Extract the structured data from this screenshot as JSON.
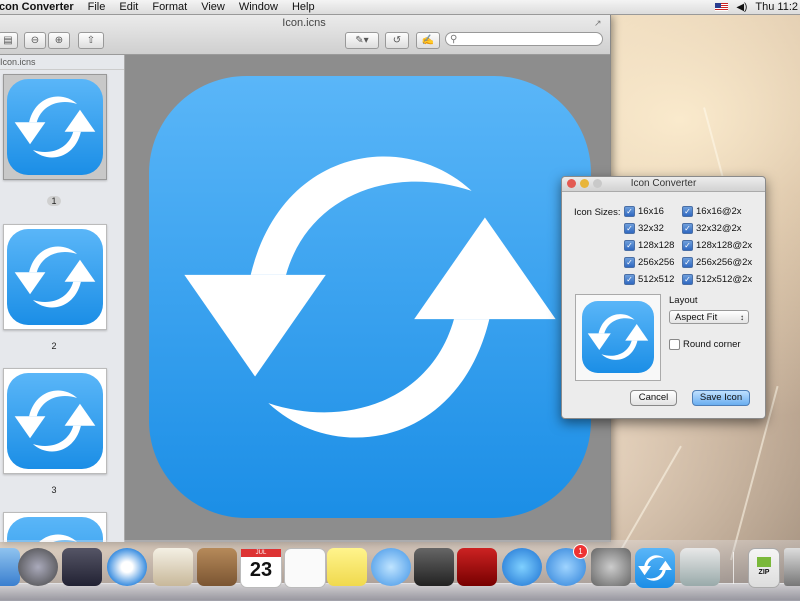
{
  "menubar": {
    "app_name": "Icon Converter",
    "menus": [
      "File",
      "Edit",
      "Format",
      "View",
      "Window",
      "Help"
    ],
    "clock": "Thu 11:2"
  },
  "preview": {
    "title": "Icon.icns",
    "sidebar_title": "Icon.icns",
    "pages": [
      "1",
      "2",
      "3"
    ],
    "search_placeholder": ""
  },
  "dialog": {
    "title": "Icon Converter",
    "icon_sizes_label": "Icon Sizes:",
    "sizes_left": [
      "16x16",
      "32x32",
      "128x128",
      "256x256",
      "512x512"
    ],
    "sizes_right": [
      "16x16@2x",
      "32x32@2x",
      "128x128@2x",
      "256x256@2x",
      "512x512@2x"
    ],
    "layout_label": "Layout",
    "layout_value": "Aspect Fit",
    "round_corner_label": "Round corner",
    "cancel_label": "Cancel",
    "save_label": "Save Icon"
  },
  "colors": {
    "icon_blue_top": "#5ab6f8",
    "icon_blue_bottom": "#1b8ee6"
  },
  "dock": {
    "zip_label": "ZIP",
    "calendar_day": "23",
    "calendar_month": "JUL",
    "appstore_badge": "1",
    "items": [
      "finder-icon",
      "launchpad-icon",
      "mission-control-icon",
      "safari-icon",
      "mail-icon",
      "contacts-icon",
      "calendar-icon",
      "reminders-icon",
      "notes-icon",
      "messages-icon",
      "facetime-icon",
      "photo-booth-icon",
      "itunes-icon",
      "app-store-icon",
      "system-preferences-icon",
      "icon-converter-icon",
      "preview-icon",
      "zip-archive-icon",
      "trash-icon"
    ]
  }
}
